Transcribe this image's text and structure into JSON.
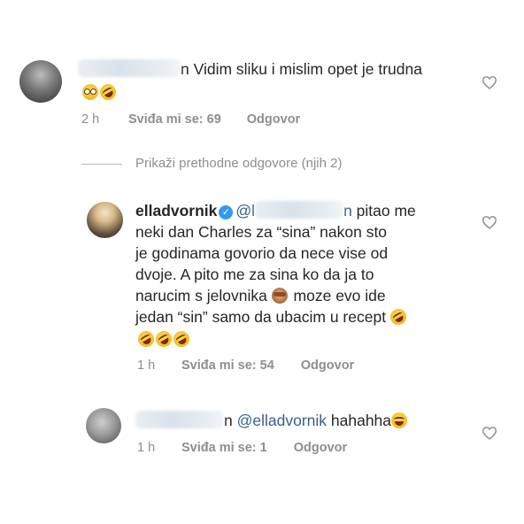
{
  "comments": [
    {
      "username_fragment": "n",
      "text": "Vidim sliku i mislim opet je trudna",
      "emoji": [
        "flushed-face-emoji",
        "rofl-emoji"
      ],
      "time": "2 h",
      "likes": "Sviđa mi se: 69",
      "reply": "Odgovor"
    },
    {
      "username": "elladvornik",
      "mention_prefix": "@l",
      "mention_suffix": "n",
      "line1_tail": " pitao me",
      "lines": [
        "neki dan Charles za “sina” nakon sto",
        "je godinama govorio da nece vise od",
        "dvoje. A pito me za sina ko da ja to",
        "narucim s jelovnika",
        " moze evo ide",
        "jedan “sin” samo da ubacim u recept"
      ],
      "time": "1 h",
      "likes": "Sviđa mi se: 54",
      "reply": "Odgovor"
    },
    {
      "username_fragment": "n",
      "mention": "@elladvornik",
      "text": " hahahha",
      "time": "1 h",
      "likes": "Sviđa mi se: 1",
      "reply": "Odgovor"
    }
  ],
  "view_previous": "Prikaži prethodne odgovore (njih 2)",
  "colors": {
    "text": "#262626",
    "meta": "#8e8e8e",
    "mention": "#3a5f8d",
    "verified": "#3897f0"
  }
}
